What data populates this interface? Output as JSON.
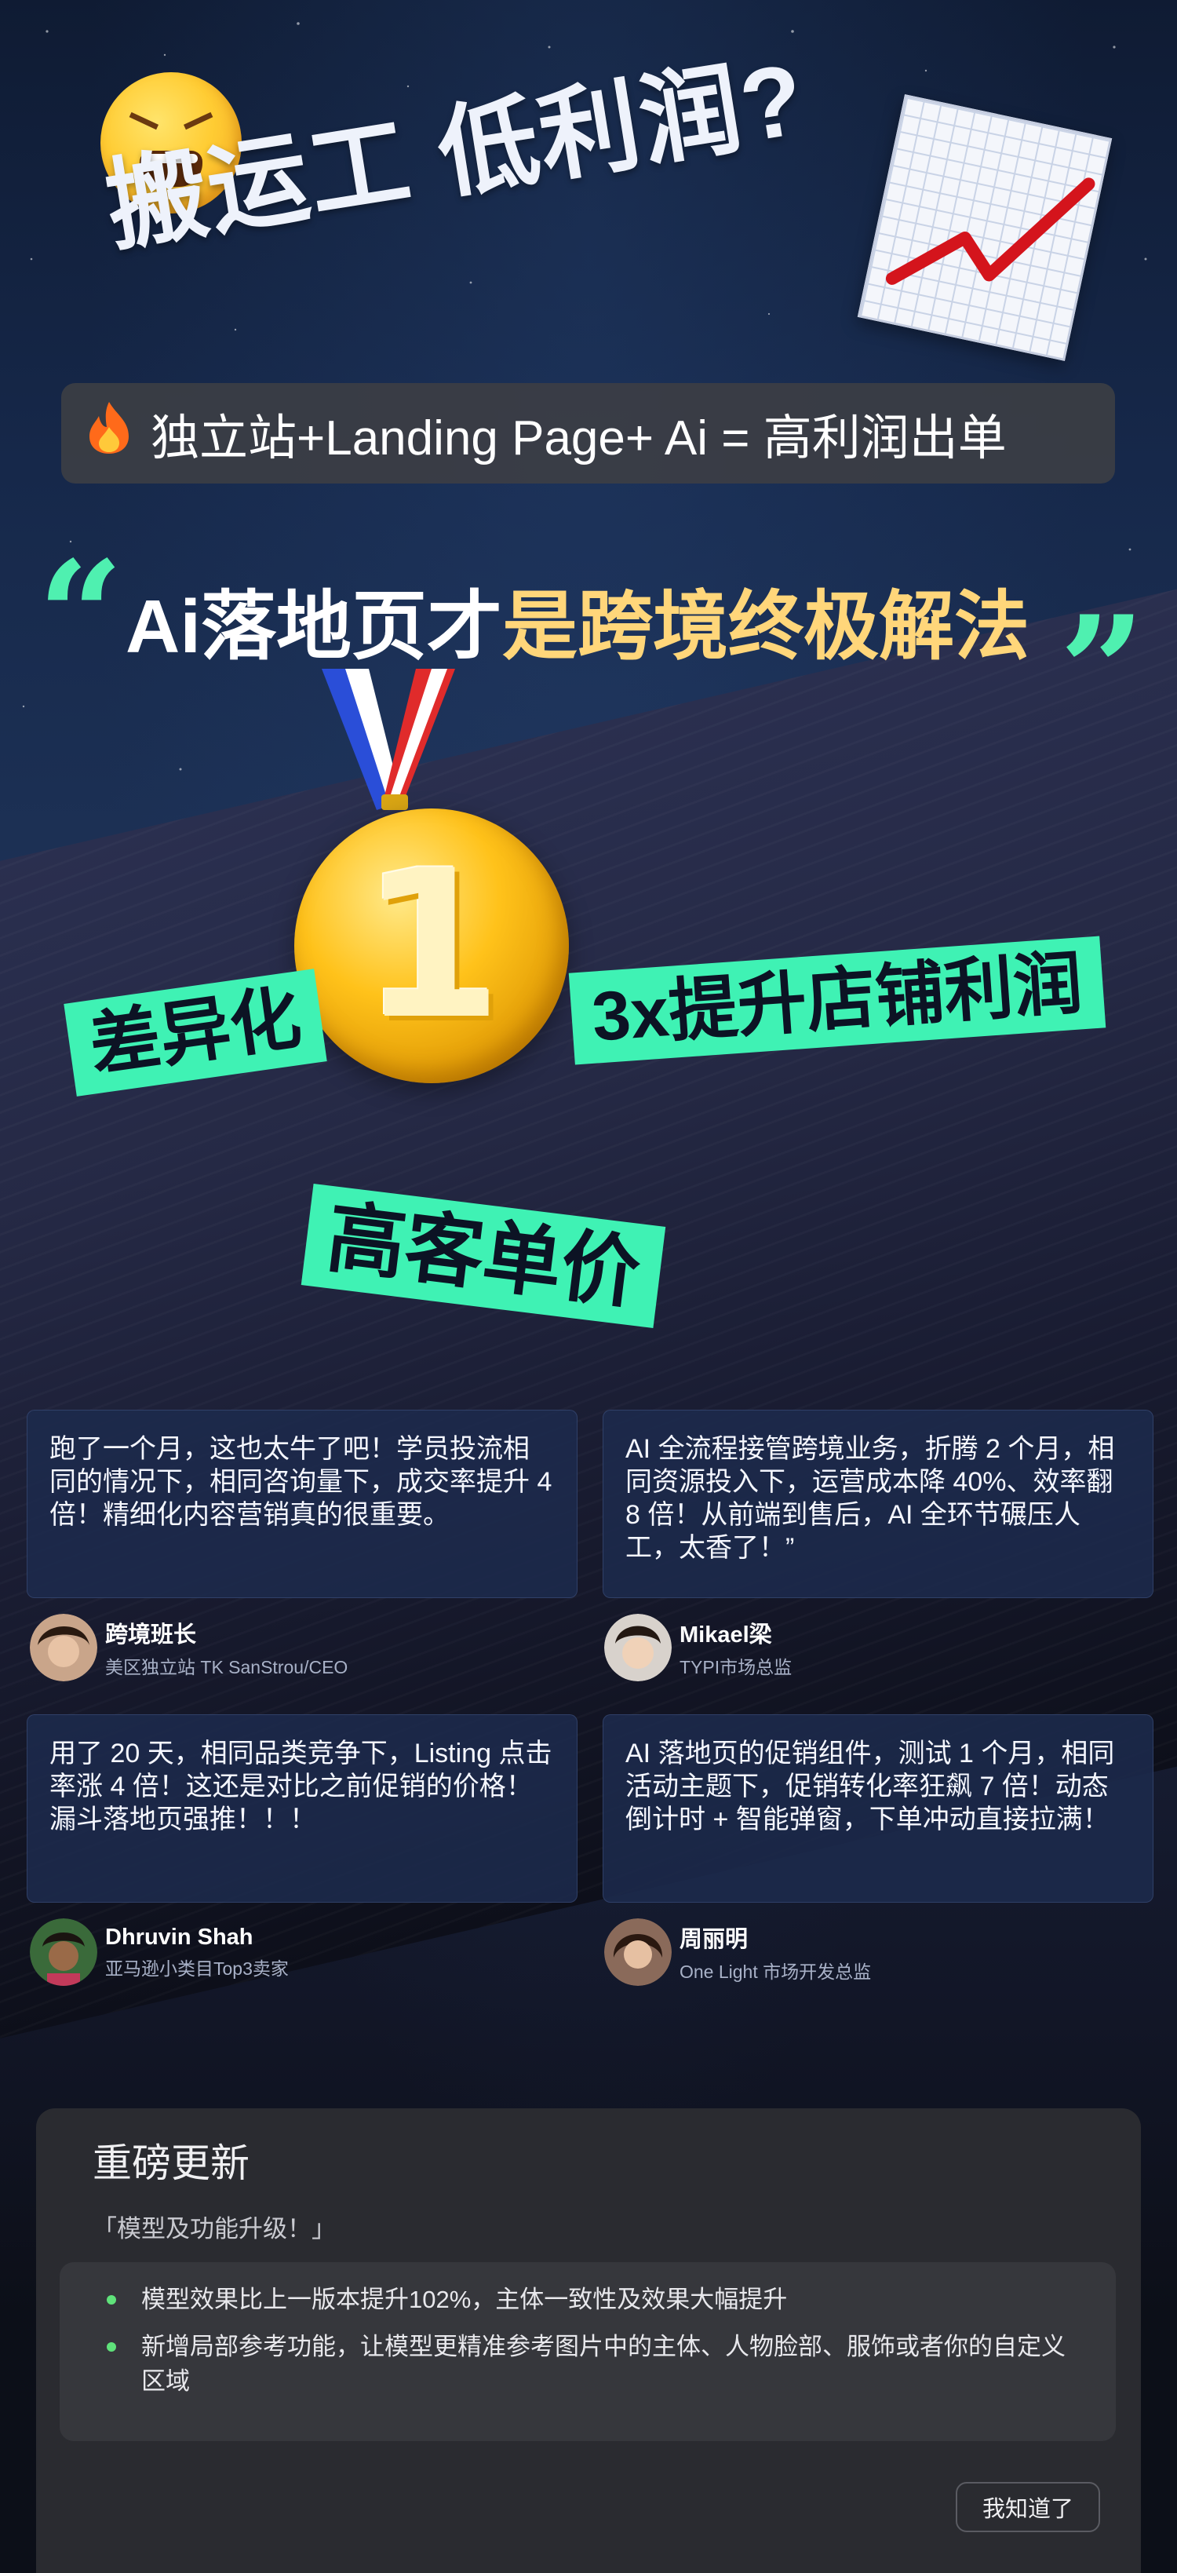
{
  "headline": {
    "text": "搬运工 低利润?"
  },
  "formula": {
    "icon": "fire-icon",
    "text": "独立站+Landing Page+ Ai = 高利润出单"
  },
  "title": {
    "part1": "Ai落地页才",
    "part2": "是跨境终极解法",
    "quote_open": "“",
    "quote_close": "”"
  },
  "medal": {
    "number": "1"
  },
  "tags": {
    "differentiation": "差异化",
    "profit": "3x提升店铺利润",
    "price": "高客单价"
  },
  "testimonials": [
    {
      "text": "跑了一个月，这也太牛了吧！学员投流相同的情况下，相同咨询量下，成交率提升 4 倍！精细化内容营销真的很重要。",
      "name": "跨境班长",
      "role": "美区独立站 TK SanStrou/CEO"
    },
    {
      "text": "AI 全流程接管跨境业务，折腾 2 个月，相同资源投入下，运营成本降 40%、效率翻 8 倍！从前端到售后，AI 全环节碾压人工，太香了！”",
      "name": "Mikael梁",
      "role": "TYPI市场总监"
    },
    {
      "text": "用了 20 天，相同品类竞争下，Listing 点击率涨 4 倍！这还是对比之前促销的价格！漏斗落地页强推！！！",
      "name": "Dhruvin Shah",
      "role": "亚马逊小类目Top3卖家"
    },
    {
      "text": "AI 落地页的促销组件，测试 1 个月，相同活动主题下，促销转化率狂飙 7 倍！动态倒计时 + 智能弹窗，下单冲动直接拉满！",
      "name": "周丽明",
      "role": "One Light 市场开发总监"
    }
  ],
  "update_dialog": {
    "title": "重磅更新",
    "subtitle": "「模型及功能升级！」",
    "items": [
      "模型效果比上一版本提升102%，主体一致性及效果大幅提升",
      "新增局部参考功能，让模型更精准参考图片中的主体、人物脸部、服饰或者你的自定义区域"
    ],
    "confirm_label": "我知道了"
  },
  "colors": {
    "accent_green": "#3ff2b4",
    "title_gold": "#ffd67a",
    "bullet_green": "#5fe27a"
  }
}
